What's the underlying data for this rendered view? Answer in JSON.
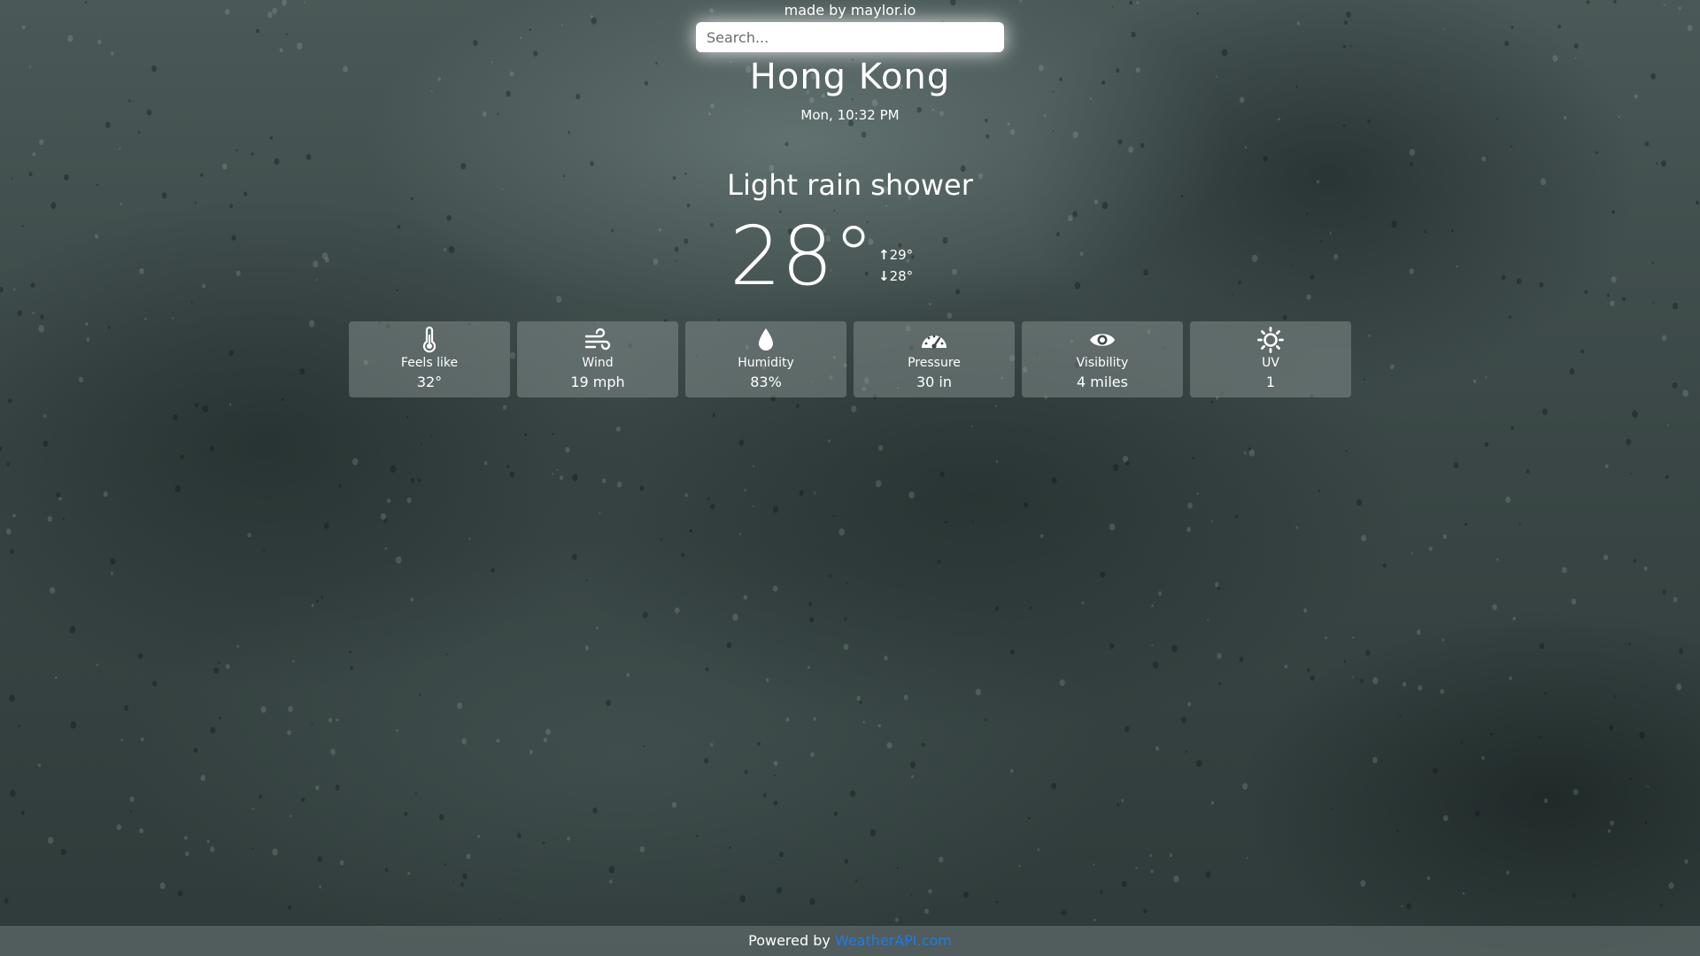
{
  "header": {
    "credit": "made by maylor.io"
  },
  "search": {
    "placeholder": "Search..."
  },
  "location": {
    "city": "Hong Kong",
    "datetime": "Mon, 10:32 PM"
  },
  "weather": {
    "condition": "Light rain shower",
    "temperature": "28°",
    "high": "29°",
    "low": "28°",
    "high_arrow": "↑",
    "low_arrow": "↓"
  },
  "cards": [
    {
      "label": "Feels like",
      "value": "32°",
      "icon": "thermometer-icon"
    },
    {
      "label": "Wind",
      "value": "19 mph",
      "icon": "wind-icon"
    },
    {
      "label": "Humidity",
      "value": "83%",
      "icon": "droplet-icon"
    },
    {
      "label": "Pressure",
      "value": "30 in",
      "icon": "gauge-icon"
    },
    {
      "label": "Visibility",
      "value": "4 miles",
      "icon": "eye-icon"
    },
    {
      "label": "UV",
      "value": "1",
      "icon": "sun-icon"
    }
  ],
  "footer": {
    "powered_by": "Powered by ",
    "link_text": "WeatherAPI.com",
    "link_color": "#1e7be6"
  },
  "colors": {
    "text": "#ffffff",
    "background": "#3b4847"
  }
}
